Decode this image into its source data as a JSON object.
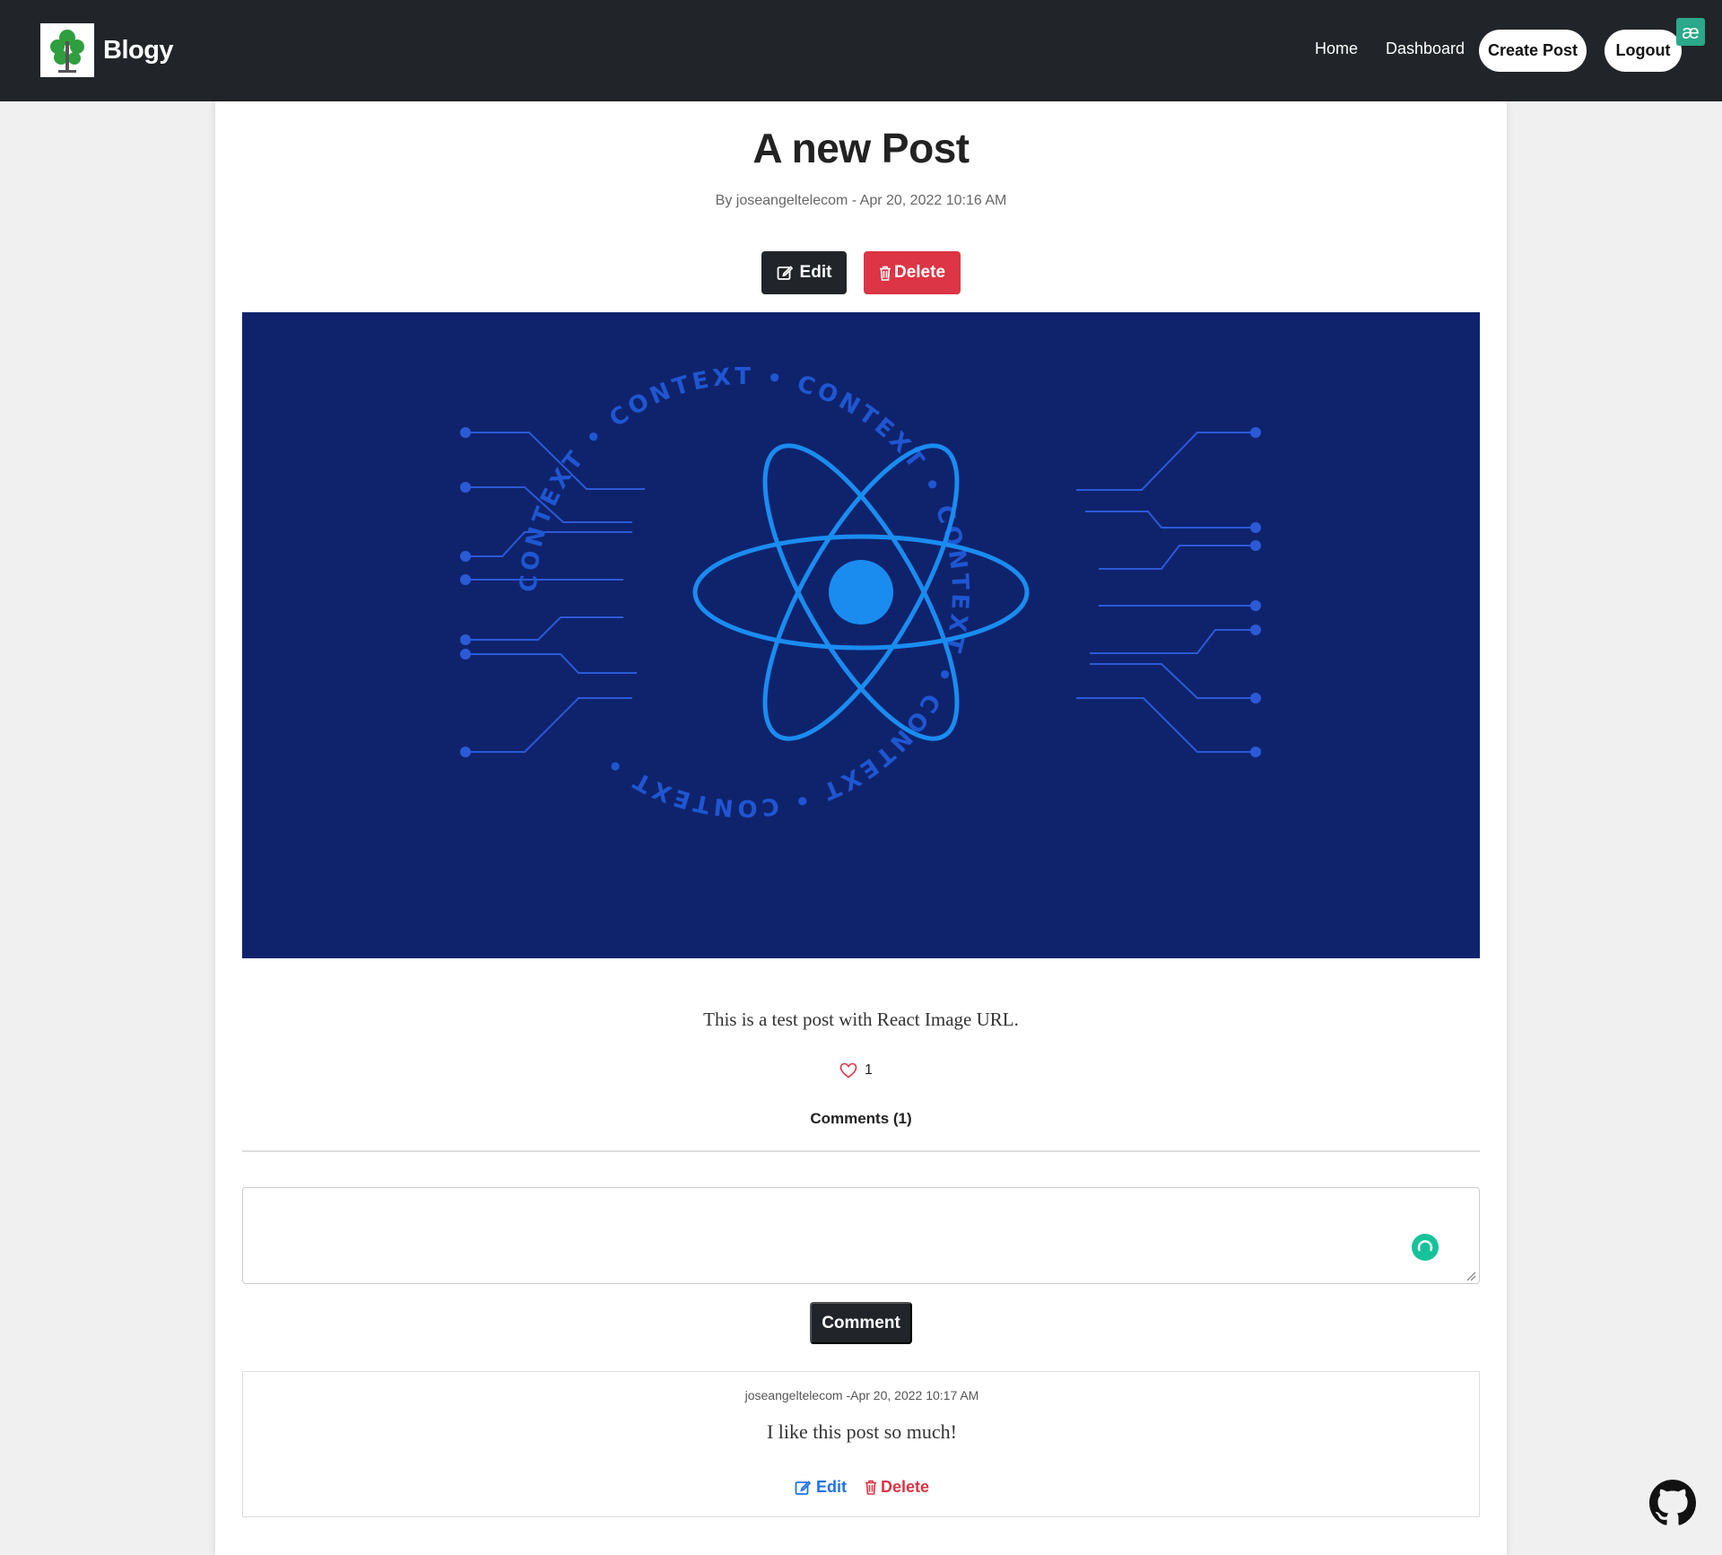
{
  "brand": {
    "name": "Blogy",
    "logo_icon": "tree-logo-icon"
  },
  "nav": {
    "home": "Home",
    "dashboard": "Dashboard",
    "create_post": "Create Post",
    "logout": "Logout",
    "extension_badge": "æ"
  },
  "post": {
    "title": "A new Post",
    "byline": "By joseangeltelecom - Apr 20, 2022 10:16 AM",
    "edit_label": "Edit",
    "delete_label": "Delete",
    "image": {
      "ring_text": "CONTEXT",
      "colors": {
        "background": "#0f236d",
        "line": "#2c5ad6",
        "atom": "#1a8cf0"
      }
    },
    "body": "This is a test post with React Image URL.",
    "likes": "1",
    "comments_heading": "Comments (1)"
  },
  "comment_form": {
    "value": "",
    "submit_label": "Comment"
  },
  "comments": [
    {
      "meta": "joseangeltelecom -Apr 20, 2022 10:17 AM",
      "text": "I like this post so much!",
      "edit_label": "Edit",
      "delete_label": "Delete"
    }
  ],
  "colors": {
    "navbar": "#212529",
    "danger": "#dc3545",
    "link": "#1e73e8",
    "grammarly": "#15c39a"
  }
}
